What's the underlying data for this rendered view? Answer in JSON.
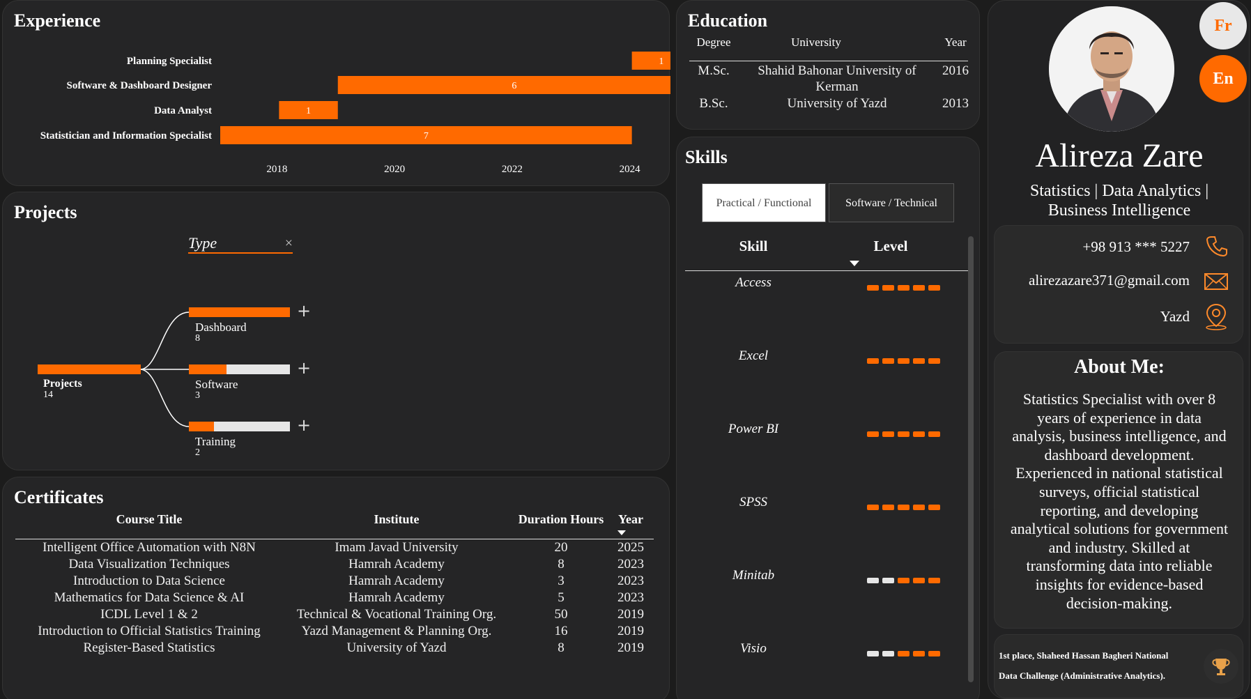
{
  "colors": {
    "accent": "#ff6a00",
    "card": "#252526",
    "bg": "#1c1c1c",
    "inactive_seg": "#e6e6e6"
  },
  "experience": {
    "title": "Experience",
    "chart_data": {
      "type": "bar",
      "orientation": "horizontal-gantt",
      "categories": [
        "Planning Specialist",
        "Software & Dashboard Designer",
        "Data Analyst",
        "Statistician and Information Specialist"
      ],
      "series": [
        {
          "start": [
            2024,
            2019,
            2018,
            2017
          ],
          "end": [
            2025,
            2025,
            2019,
            2024
          ],
          "labels": [
            "1",
            "6",
            "1",
            "7"
          ]
        }
      ],
      "xticks": [
        "2018",
        "2020",
        "2022",
        "2024"
      ],
      "xlim": [
        2017,
        2025
      ]
    }
  },
  "projects": {
    "title": "Projects",
    "filter_label": "Type",
    "root": {
      "label": "Projects",
      "count": "14"
    },
    "children": [
      {
        "label": "Dashboard",
        "count": "8",
        "fraction": 1.0
      },
      {
        "label": "Software",
        "count": "3",
        "fraction": 0.375
      },
      {
        "label": "Training",
        "count": "2",
        "fraction": 0.25
      }
    ],
    "expand_symbol": "+",
    "clear_symbol": "×"
  },
  "certificates": {
    "title": "Certificates",
    "headers": [
      "Course Title",
      "Institute",
      "Duration Hours",
      "Year"
    ],
    "rows": [
      [
        "Intelligent Office Automation with N8N",
        "Imam Javad University",
        "20",
        "2025"
      ],
      [
        "Data Visualization Techniques",
        "Hamrah Academy",
        "8",
        "2023"
      ],
      [
        "Introduction to Data Science",
        "Hamrah Academy",
        "3",
        "2023"
      ],
      [
        "Mathematics for Data Science & AI",
        "Hamrah Academy",
        "5",
        "2023"
      ],
      [
        "ICDL Level 1 & 2",
        "Technical & Vocational Training Org.",
        "50",
        "2019"
      ],
      [
        "Introduction to Official Statistics Training",
        "Yazd Management & Planning Org.",
        "16",
        "2019"
      ],
      [
        "Register-Based Statistics",
        "University of Yazd",
        "8",
        "2019"
      ]
    ]
  },
  "education": {
    "title": "Education",
    "headers": [
      "Degree",
      "University",
      "Year"
    ],
    "rows": [
      {
        "degree": "M.Sc.",
        "university_line1": "Shahid Bahonar University of",
        "university_line2": "Kerman",
        "year": "2016"
      },
      {
        "degree": "B.Sc.",
        "university_line1": "University of Yazd",
        "university_line2": "",
        "year": "2013"
      }
    ]
  },
  "skills": {
    "title": "Skills",
    "tabs": [
      "Practical / Functional",
      "Software / Technical"
    ],
    "headers": [
      "Skill",
      "Level"
    ],
    "rows": [
      {
        "name": "Access",
        "level": 5
      },
      {
        "name": "Excel",
        "level": 5
      },
      {
        "name": "Power BI",
        "level": 5
      },
      {
        "name": "SPSS",
        "level": 5
      },
      {
        "name": "Minitab",
        "level": 3
      },
      {
        "name": "Visio",
        "level": 3
      }
    ],
    "max_level": 5
  },
  "profile": {
    "lang_fr": "Fr",
    "lang_en": "En",
    "name": "Alireza Zare",
    "subtitle_line1": "Statistics | Data Analytics |",
    "subtitle_line2": "Business Intelligence",
    "phone": "+98 913 *** 5227",
    "email": "alirezazare371@gmail.com",
    "city": "Yazd"
  },
  "about": {
    "title": "About Me:",
    "lines": [
      "Statistics Specialist with over 8",
      "years of experience in data",
      "analysis, business intelligence, and",
      "dashboard development.",
      "Experienced in national statistical",
      "surveys, official statistical",
      "reporting, and developing",
      "analytical solutions for government",
      "and industry. Skilled at",
      "transforming data into reliable",
      "insights for evidence-based",
      "decision-making."
    ]
  },
  "award": {
    "line1": "1st place, Shaheed Hassan Bagheri National",
    "line2": "Data Challenge (Administrative Analytics)."
  }
}
